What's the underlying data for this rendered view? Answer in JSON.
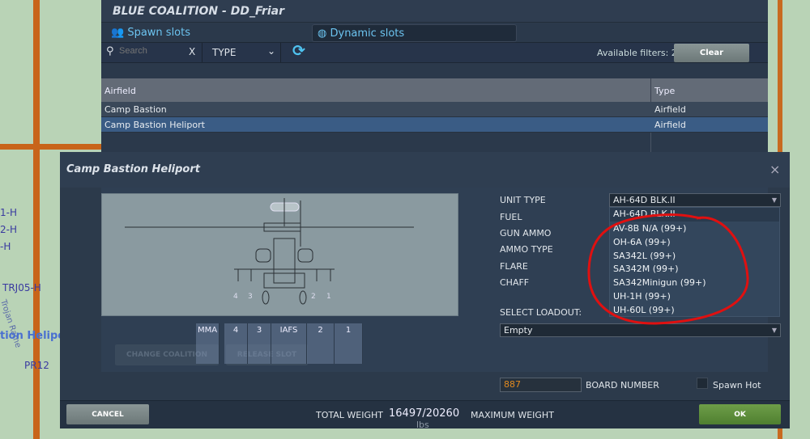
{
  "map": {
    "labels": [
      "1-H",
      "2-H",
      "-H",
      "TRJ05-H",
      "tion Heliport",
      "PR12",
      "Trojan Rame"
    ]
  },
  "top_panel": {
    "title": "BLUE COALITION - DD_Friar",
    "tabs": [
      {
        "label": "Spawn slots",
        "icon": "users-icon"
      },
      {
        "label": "Dynamic slots",
        "icon": "leaf-icon"
      }
    ],
    "search": {
      "placeholder": "Search",
      "clear": "X"
    },
    "type_filter": "TYPE",
    "available_filters": "Available filters: 2",
    "clear_label": "Clear",
    "columns": [
      "Airfield",
      "Type"
    ],
    "rows": [
      {
        "airfield": "Camp Bastion",
        "type": "Airfield"
      },
      {
        "airfield": "Camp Bastion Heliport",
        "type": "Airfield",
        "selected": true
      }
    ]
  },
  "modal": {
    "title": "Camp Bastion Heliport",
    "close": "×",
    "pylon_labels": [
      "4",
      "3",
      "2",
      "1"
    ],
    "pylons": [
      "MMA",
      "4",
      "3",
      "IAFS",
      "2",
      "1"
    ],
    "change_coalition": "CHANGE COALITION",
    "release_slot": "RELEASE SLOT",
    "fields": [
      "UNIT TYPE",
      "FUEL",
      "GUN AMMO",
      "AMMO TYPE",
      "FLARE",
      "CHAFF"
    ],
    "unit_type": "AH-64D BLK.II",
    "unit_options": [
      "AH-64D BLK.II",
      "AV-8B N/A (99+)",
      "OH-6A (99+)",
      "SA342L (99+)",
      "SA342M (99+)",
      "SA342Minigun (99+)",
      "UH-1H (99+)",
      "UH-60L (99+)"
    ],
    "select_loadout_label": "SELECT LOADOUT:",
    "loadout": "Empty",
    "board_number": "887",
    "board_number_label": "BOARD NUMBER",
    "spawn_hot": "Spawn Hot",
    "cancel": "CANCEL",
    "total_weight_label": "TOTAL WEIGHT",
    "total_weight": "16497/20260",
    "weight_unit": "lbs",
    "maximum_weight_label": "MAXIMUM WEIGHT",
    "ok": "OK",
    "annotation_color": "#e01010"
  }
}
